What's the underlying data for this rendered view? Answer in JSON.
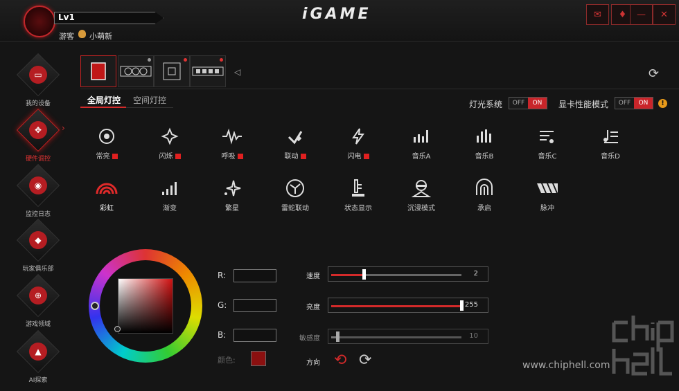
{
  "header": {
    "level": "Lv1",
    "user_type": "游客",
    "rank": "小萌新",
    "logo": "iGAME",
    "buttons": {
      "mail": "✉",
      "skin": "♦",
      "minimize": "—",
      "close": "✕"
    }
  },
  "sidebar": {
    "items": [
      {
        "label": "我的设备",
        "icon": "monitor-icon"
      },
      {
        "label": "硬件调控",
        "icon": "control-dial-icon",
        "active": true
      },
      {
        "label": "监控日志",
        "icon": "monitor-log-icon"
      },
      {
        "label": "玩家俱乐部",
        "icon": "club-icon"
      },
      {
        "label": "游戏领域",
        "icon": "gamepad-icon"
      },
      {
        "label": "AI探索",
        "icon": "ai-icon"
      }
    ]
  },
  "devices": [
    "case-icon",
    "gpu-icon",
    "motherboard-icon",
    "memory-icon"
  ],
  "subtabs": {
    "global": "全局灯控",
    "spatial": "空间灯控"
  },
  "toggles": {
    "light_system": {
      "label": "灯光系统",
      "off": "OFF",
      "on": "ON"
    },
    "gpu_perf": {
      "label": "显卡性能模式",
      "off": "OFF",
      "on": "ON"
    }
  },
  "effects": [
    {
      "label": "常亮",
      "marked": true
    },
    {
      "label": "闪烁",
      "marked": true
    },
    {
      "label": "呼吸",
      "marked": true
    },
    {
      "label": "联动",
      "marked": true
    },
    {
      "label": "闪电",
      "marked": true
    },
    {
      "label": "音乐A"
    },
    {
      "label": "音乐B"
    },
    {
      "label": "音乐C"
    },
    {
      "label": "音乐D"
    },
    {
      "label": "彩虹"
    },
    {
      "label": "渐变"
    },
    {
      "label": "繁星"
    },
    {
      "label": "雷蛇联动"
    },
    {
      "label": "状态显示"
    },
    {
      "label": "沉浸模式"
    },
    {
      "label": "承启"
    },
    {
      "label": "脉冲"
    }
  ],
  "color": {
    "r_label": "R:",
    "g_label": "G:",
    "b_label": "B:",
    "color_label": "颜色:",
    "swatch": "#8b1010"
  },
  "sliders": {
    "speed": {
      "label": "速度",
      "value": "2",
      "fraction": 0.25
    },
    "brightness": {
      "label": "亮度",
      "value": "255",
      "fraction": 1.0
    },
    "sensitivity": {
      "label": "敏感度",
      "value": "10",
      "fraction": 0.05
    },
    "direction": {
      "label": "方向"
    }
  },
  "watermark": "www.chiphell.com",
  "chip_logo": "chip hell"
}
